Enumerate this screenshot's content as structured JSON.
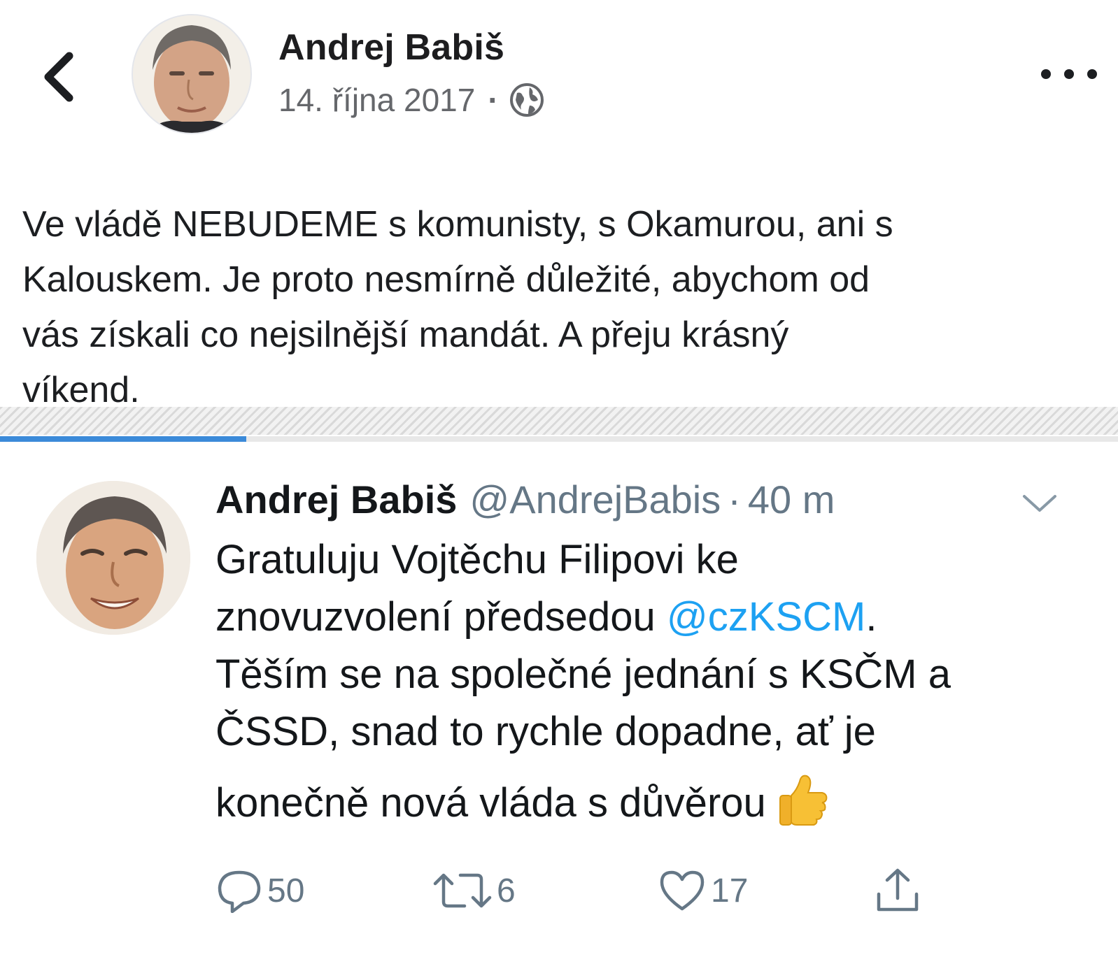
{
  "facebook_post": {
    "author": "Andrej Babiš",
    "date": "14. října 2017",
    "separator": "·",
    "privacy_icon": "globe-icon",
    "text_lines": [
      "Ve vládě NEBUDEME s komunisty, s Okamurou, ani s",
      "Kalouskem. Je proto nesmírně důležité, abychom od",
      "vás získali co nejsilnější mandát. A přeju krásný",
      "víkend."
    ]
  },
  "progress": {
    "fraction": 0.22,
    "color": "#3b8ad9"
  },
  "tweet": {
    "name": "Andrej Babiš",
    "handle": "@AndrejBabis",
    "separator": "·",
    "time": "40 m",
    "text": {
      "line1": "Gratuluju Vojtěchu Filipovi ke",
      "line2_before": "znovuzvolení předsedou ",
      "line2_mention": "@czKSCM",
      "line2_after": ".",
      "line3": "Těším se na společné jednání s KSČM a",
      "line4": "ČSSD, snad to rychle dopadne, ať je",
      "line5": "konečně nová vláda s důvěrou",
      "emoji": "thumbs-up-emoji"
    },
    "actions": {
      "reply_count": "50",
      "retweet_count": "6",
      "like_count": "17"
    },
    "colors": {
      "mention": "#1da1f2",
      "meta": "#657786"
    }
  }
}
